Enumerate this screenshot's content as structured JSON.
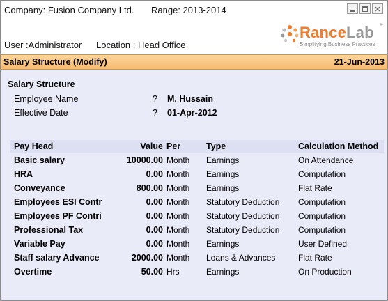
{
  "header": {
    "company_label": "Company: Fusion Company Ltd.",
    "range_label": "Range: 2013-2014",
    "user_label": "User :Administrator",
    "location_label": "Location : Head Office",
    "window_controls": [
      "minimize-icon",
      "maximize-icon",
      "close-icon"
    ],
    "logo": {
      "part1": "Rance",
      "part2": "Lab",
      "registered": "®",
      "tagline": "Simplifying Business Practices",
      "colors": {
        "rance": "#ef7d2d",
        "lab": "#999999"
      }
    }
  },
  "title_bar": {
    "title": "Salary Structure (Modify)",
    "date": "21-Jun-2013",
    "background": "#f7bb72"
  },
  "section": {
    "title": "Salary Structure",
    "employee_label": "Employee Name",
    "employee_sep": "?",
    "employee_value": "M. Hussain",
    "effective_label": "Effective Date",
    "effective_sep": "?",
    "effective_value": "01-Apr-2012"
  },
  "table": {
    "headers": {
      "pay_head": "Pay Head",
      "value": "Value",
      "per": "Per",
      "type": "Type",
      "calc": "Calculation Method"
    },
    "rows": [
      {
        "pay_head": "Basic salary",
        "value": "10000.00",
        "per": "Month",
        "type": "Earnings",
        "calc": "On Attendance"
      },
      {
        "pay_head": "HRA",
        "value": "0.00",
        "per": "Month",
        "type": "Earnings",
        "calc": "Computation"
      },
      {
        "pay_head": "Conveyance",
        "value": "800.00",
        "per": "Month",
        "type": "Earnings",
        "calc": "Flat Rate"
      },
      {
        "pay_head": "Employees ESI Contr",
        "value": "0.00",
        "per": "Month",
        "type": "Statutory Deduction",
        "calc": "Computation"
      },
      {
        "pay_head": "Employees PF Contri",
        "value": "0.00",
        "per": "Month",
        "type": "Statutory Deduction",
        "calc": "Computation"
      },
      {
        "pay_head": "Professional Tax",
        "value": "0.00",
        "per": "Month",
        "type": "Statutory Deduction",
        "calc": "Computation"
      },
      {
        "pay_head": "Variable Pay",
        "value": "0.00",
        "per": "Month",
        "type": "Earnings",
        "calc": "User Defined"
      },
      {
        "pay_head": "Staff salary Advance",
        "value": "2000.00",
        "per": "Month",
        "type": "Loans & Advances",
        "calc": "Flat Rate"
      },
      {
        "pay_head": "Overtime",
        "value": "50.00",
        "per": "Hrs",
        "type": "Earnings",
        "calc": "On Production"
      }
    ]
  }
}
